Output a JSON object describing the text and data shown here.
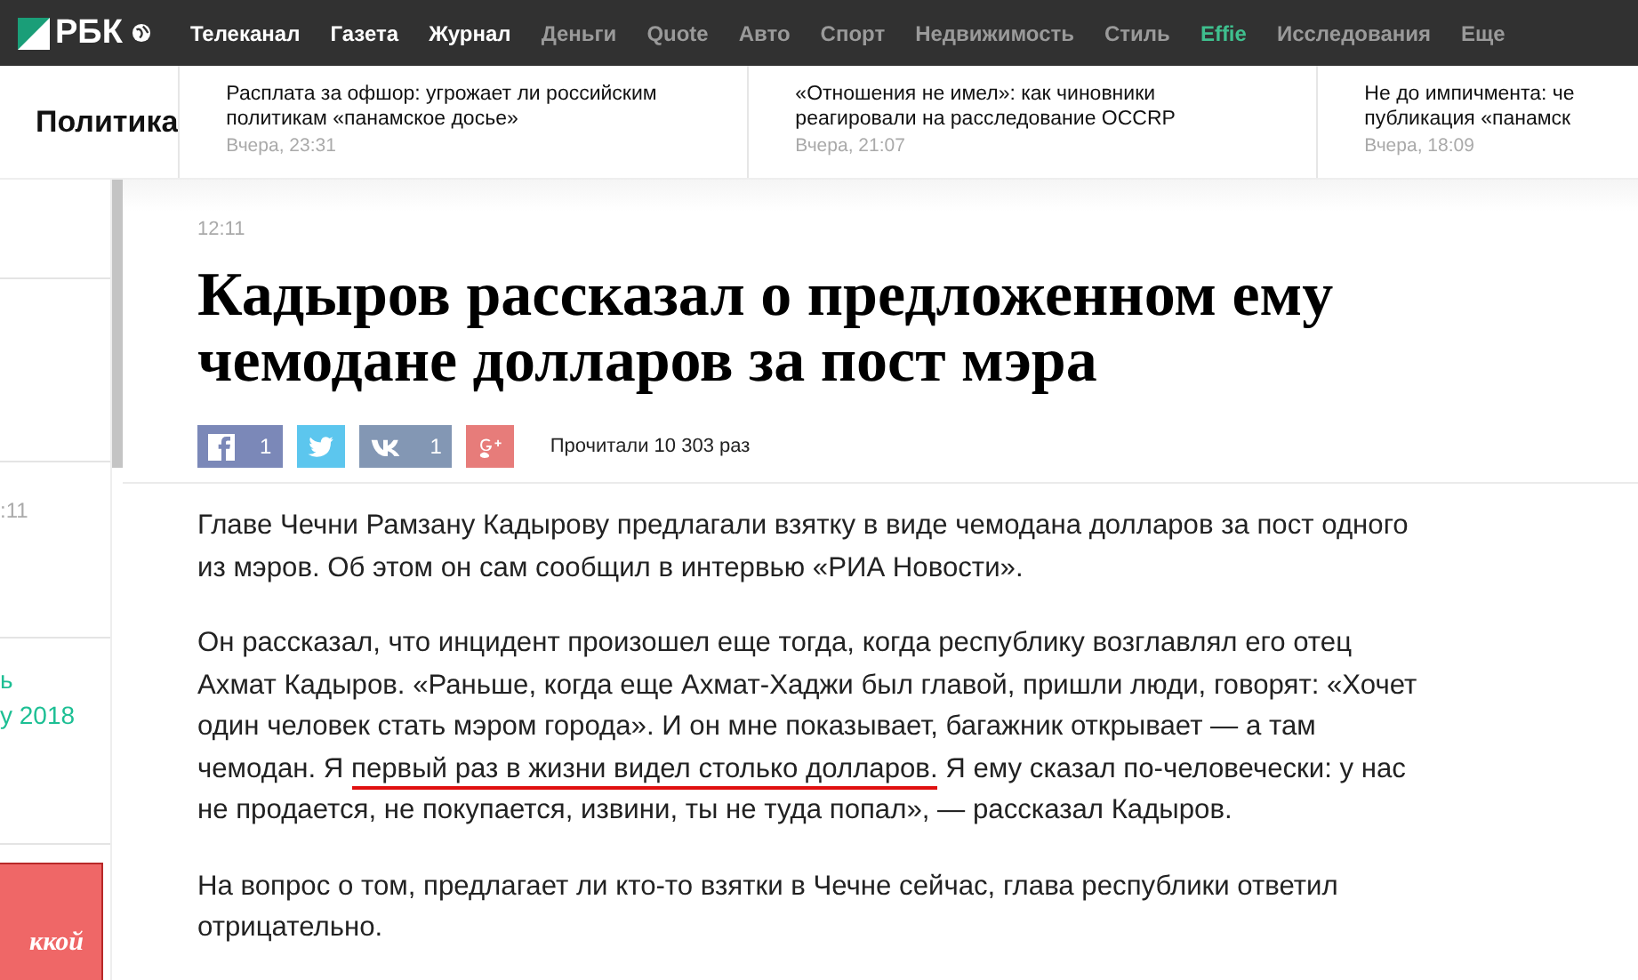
{
  "logo": {
    "text": "РБК"
  },
  "nav": [
    {
      "label": "Телеканал",
      "kind": "primary"
    },
    {
      "label": "Газета",
      "kind": "primary"
    },
    {
      "label": "Журнал",
      "kind": "primary"
    },
    {
      "label": "Деньги",
      "kind": "secondary"
    },
    {
      "label": "Quote",
      "kind": "secondary"
    },
    {
      "label": "Авто",
      "kind": "secondary"
    },
    {
      "label": "Спорт",
      "kind": "secondary"
    },
    {
      "label": "Недвижимость",
      "kind": "secondary"
    },
    {
      "label": "Стиль",
      "kind": "secondary"
    },
    {
      "label": "Effie",
      "kind": "accent"
    },
    {
      "label": "Исследования",
      "kind": "secondary"
    },
    {
      "label": "Еще",
      "kind": "secondary"
    }
  ],
  "section": "Политика",
  "headlines": [
    {
      "title": "Расплата за офшор: угрожает ли российским политикам «панамское досье»",
      "time": "Вчера, 23:31"
    },
    {
      "title": "«Отношения не имел»: как чиновники реагировали на расследование OCCRP",
      "time": "Вчера, 21:07"
    },
    {
      "title": "Не до импичмента: че\nпубликация «панамск",
      "time": "Вчера, 18:09"
    }
  ],
  "sidebar": [
    {
      "text": ":11",
      "kind": "time"
    },
    {
      "text": "ь",
      "kind": "link"
    },
    {
      "text": "у 2018",
      "kind": "link"
    },
    {
      "text": "ккой",
      "kind": "banner"
    }
  ],
  "article": {
    "time": "12:11",
    "title": "Кадыров рассказал о предложенном ему чемодане долларов за пост мэра",
    "shares": [
      {
        "kind": "facebook",
        "count": "1"
      },
      {
        "kind": "twitter"
      },
      {
        "kind": "vk",
        "count": "1"
      },
      {
        "kind": "gplus"
      }
    ],
    "reads": "Прочитали 10 303 раз",
    "paragraphs": [
      [
        {
          "text": "Главе Чечни Рамзану Кадырову предлагали взятку в виде чемодана долларов за пост одного из мэров. Об этом он сам сообщил в интервью «РИА Новости»."
        }
      ],
      [
        {
          "text": "Он рассказал, что инцидент произошел еще тогда, когда республику возглавлял его отец Ахмат Кадыров. «Раньше, когда еще Ахмат-Хаджи был главой, пришли люди, говорят: «Хочет один человек стать мэром города». И он мне показывает, багажник открывает — а там чемодан. Я "
        },
        {
          "text": "первый раз в жизни видел столько долларов.",
          "annotated": true
        },
        {
          "text": " Я ему сказал по-человечески: у нас не продается, не покупается, извини, ты не туда попал», — рассказал Кадыров."
        }
      ],
      [
        {
          "text": "На вопрос о том, предлагает ли кто-то взятки в Чечне сейчас, глава республики ответил отрицательно."
        }
      ]
    ]
  }
}
